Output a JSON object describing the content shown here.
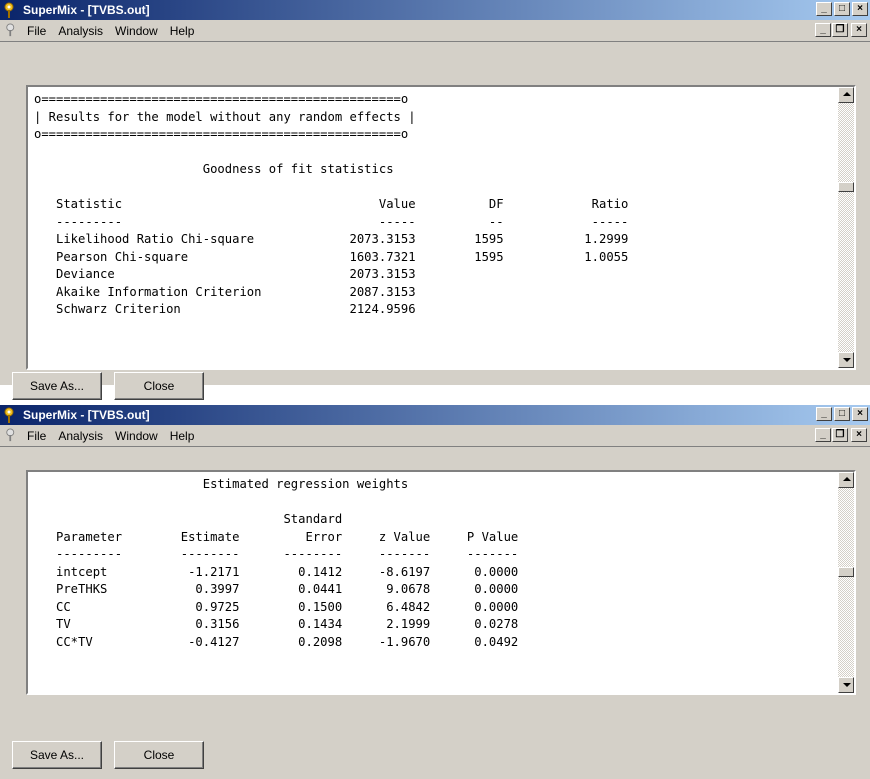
{
  "windows": [
    {
      "title": "SuperMix - [TVBS.out]",
      "menu": [
        "File",
        "Analysis",
        "Window",
        "Help"
      ],
      "lines": [
        "o=================================================o",
        "| Results for the model without any random effects |",
        "o=================================================o",
        "",
        "                       Goodness of fit statistics",
        "",
        "   Statistic                                   Value          DF            Ratio",
        "   ---------                                   -----          --            -----",
        "   Likelihood Ratio Chi-square             2073.3153        1595           1.2999",
        "   Pearson Chi-square                      1603.7321        1595           1.0055",
        "   Deviance                                2073.3153",
        "   Akaike Information Criterion            2087.3153",
        "   Schwarz Criterion                       2124.9596"
      ],
      "buttons": {
        "save_as": "Save As...",
        "close": "Close"
      }
    },
    {
      "title": "SuperMix - [TVBS.out]",
      "menu": [
        "File",
        "Analysis",
        "Window",
        "Help"
      ],
      "lines": [
        "                       Estimated regression weights",
        "",
        "                                  Standard",
        "   Parameter        Estimate         Error     z Value     P Value",
        "   ---------        --------      --------     -------     -------",
        "   intcept           -1.2171        0.1412     -8.6197      0.0000",
        "   PreTHKS            0.3997        0.0441      9.0678      0.0000",
        "   CC                 0.9725        0.1500      6.4842      0.0000",
        "   TV                 0.3156        0.1434      2.1999      0.0278",
        "   CC*TV             -0.4127        0.2098     -1.9670      0.0492"
      ],
      "buttons": {
        "save_as": "Save As...",
        "close": "Close"
      }
    }
  ],
  "icons": {
    "app": "supermix-logo-icon",
    "minimize": "minimize-icon",
    "maximize": "maximize-icon",
    "restore": "restore-icon",
    "close": "close-icon"
  },
  "colors": {
    "titlebar_start": "#0a246a",
    "titlebar_end": "#a6caf0",
    "chrome": "#d4d0c8"
  }
}
